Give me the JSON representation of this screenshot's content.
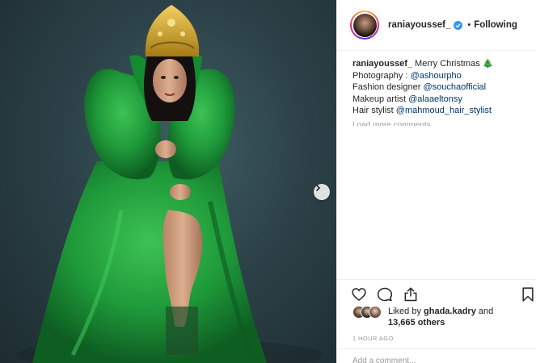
{
  "post": {
    "author": {
      "username": "raniayoussef_",
      "verified": true,
      "follow_status": "Following"
    },
    "caption": {
      "username": "raniayoussef_",
      "text": "Merry Christmas 🎄",
      "lines": [
        {
          "prefix": "Photography : ",
          "mention": "@ashourpho"
        },
        {
          "prefix": "Fashion designer ",
          "mention": "@souchaofficial"
        },
        {
          "prefix": "Makeup artist ",
          "mention": "@alaaeltonsy"
        },
        {
          "prefix": "Hair stylist ",
          "mention": "@mahmoud_hair_stylist"
        }
      ]
    },
    "load_more": "Load more comments",
    "likes": {
      "prefix": "Liked by ",
      "user": "ghada.kadry",
      "middle": " and",
      "count_text": "13,665 others"
    },
    "timestamp": "1 HOUR AGO",
    "comment_placeholder": "Add a comment...",
    "icons": {
      "like": "heart-icon",
      "comment": "comment-icon",
      "share": "share-icon",
      "save": "bookmark-icon",
      "next": "chevron-right-icon",
      "verified": "verified-badge-icon"
    },
    "colors": {
      "link": "#003569",
      "verified": "#3897f0",
      "dress": "#1f9a3a",
      "background": "#2c4248"
    }
  }
}
